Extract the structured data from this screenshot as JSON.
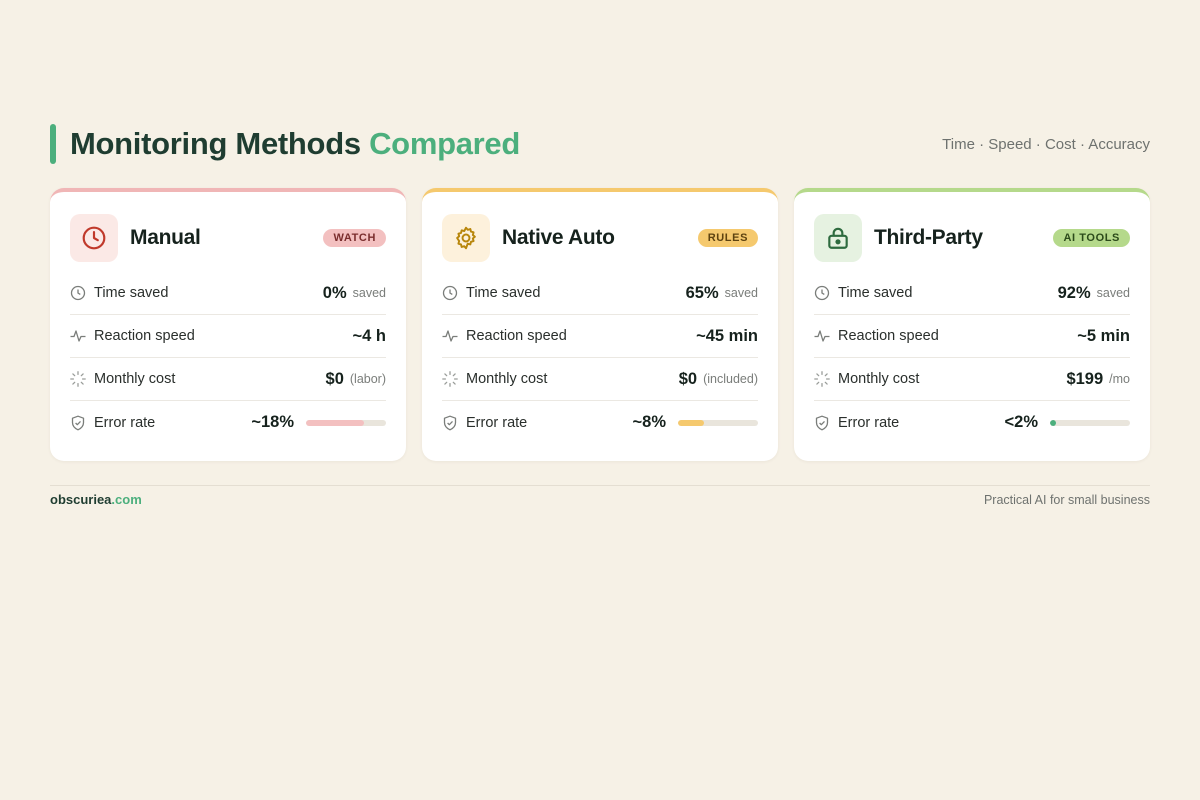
{
  "header": {
    "title_main": "Monitoring Methods",
    "title_accent": "Compared",
    "subtitle": "Time · Speed · Cost · Accuracy"
  },
  "colors": {
    "accent": "#4caf7d",
    "manual": "#f0b6b6",
    "native": "#f5c96e",
    "third": "#b5d98b",
    "background": "#f6f1e6"
  },
  "cards": [
    {
      "name": "Manual",
      "badge": "WATCH",
      "icon": "clock-icon",
      "metrics": {
        "time_saved": {
          "label": "Time saved",
          "value": "0%",
          "unit": "saved"
        },
        "reaction_speed": {
          "label": "Reaction speed",
          "value": "~4 h"
        },
        "monthly_cost": {
          "label": "Monthly cost",
          "value": "$0",
          "unit": "(labor)"
        },
        "error_rate": {
          "label": "Error rate",
          "value": "~18%",
          "bar_level": 0.72
        }
      }
    },
    {
      "name": "Native Auto",
      "badge": "RULES",
      "icon": "gear-icon",
      "metrics": {
        "time_saved": {
          "label": "Time saved",
          "value": "65%",
          "unit": "saved"
        },
        "reaction_speed": {
          "label": "Reaction speed",
          "value": "~45 min"
        },
        "monthly_cost": {
          "label": "Monthly cost",
          "value": "$0",
          "unit": "(included)"
        },
        "error_rate": {
          "label": "Error rate",
          "value": "~8%",
          "bar_level": 0.32
        }
      }
    },
    {
      "name": "Third-Party",
      "badge": "AI TOOLS",
      "icon": "lock-icon",
      "metrics": {
        "time_saved": {
          "label": "Time saved",
          "value": "92%",
          "unit": "saved"
        },
        "reaction_speed": {
          "label": "Reaction speed",
          "value": "~5 min"
        },
        "monthly_cost": {
          "label": "Monthly cost",
          "value": "$199",
          "unit": "/mo"
        },
        "error_rate": {
          "label": "Error rate",
          "value": "<2%",
          "bar_level": 0.08
        }
      }
    }
  ],
  "footer": {
    "brand_main": "obscuriea",
    "brand_tld": ".com",
    "tagline": "Practical AI for small business"
  }
}
